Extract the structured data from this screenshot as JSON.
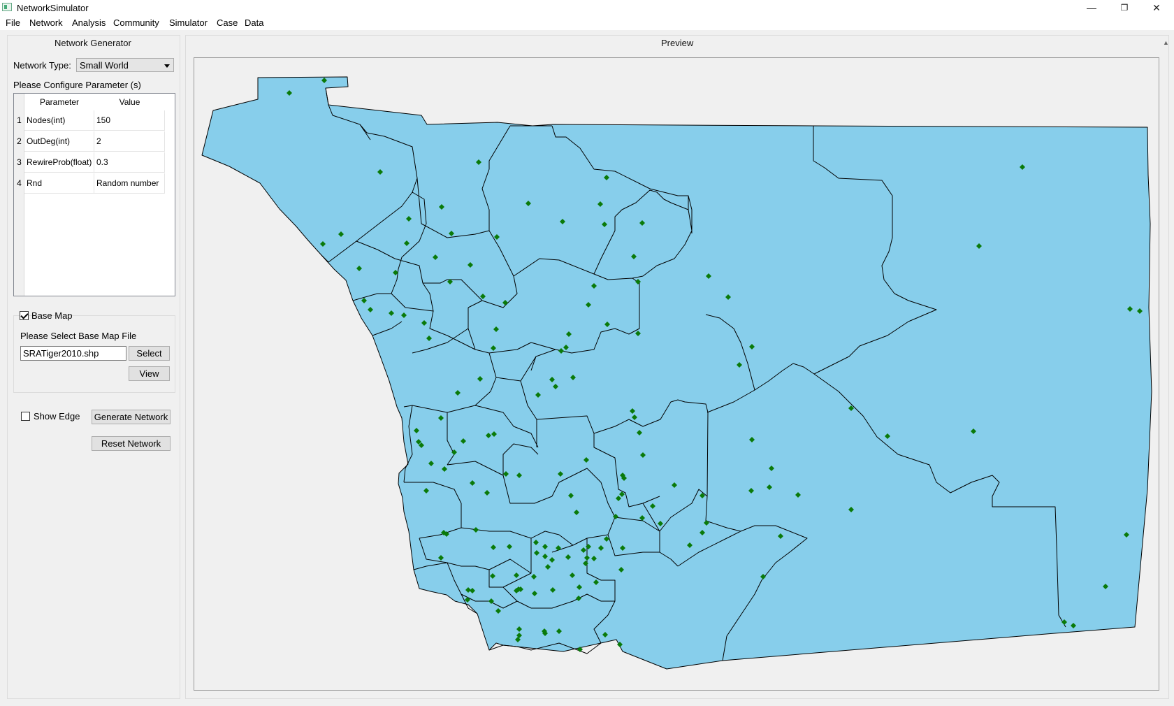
{
  "window": {
    "title": "NetworkSimulator",
    "minimize": "—",
    "restore": "❐",
    "close": "✕"
  },
  "menu": [
    "File",
    "Network",
    "Analysis",
    "Community",
    "Simulator",
    "Case",
    "Data"
  ],
  "generator": {
    "title": "Network Generator",
    "type_label": "Network Type:",
    "type_value": "Small World",
    "config_label": "Please Configure Parameter (s)",
    "table_headers": [
      "Parameter",
      "Value"
    ],
    "rows": [
      {
        "num": "1",
        "param": "Nodes(int)",
        "value": "150"
      },
      {
        "num": "2",
        "param": "OutDeg(int)",
        "value": "2"
      },
      {
        "num": "3",
        "param": "RewireProb(float)",
        "value": "0.3"
      },
      {
        "num": "4",
        "param": "Rnd",
        "value": "Random number"
      }
    ]
  },
  "basemap": {
    "label": "Base Map",
    "checked": true,
    "select_prompt": "Please Select Base Map File",
    "file_value": "SRATiger2010.shp",
    "select_button": "Select",
    "view_button": "View"
  },
  "controls": {
    "show_edge_label": "Show Edge",
    "show_edge_checked": false,
    "generate_button": "Generate Network",
    "reset_button": "Reset Network"
  },
  "preview": {
    "title": "Preview",
    "map_fill": "#87ceeb",
    "border_color": "#000000",
    "node_color": "#0a7a0a",
    "node_icon": "diamond"
  }
}
